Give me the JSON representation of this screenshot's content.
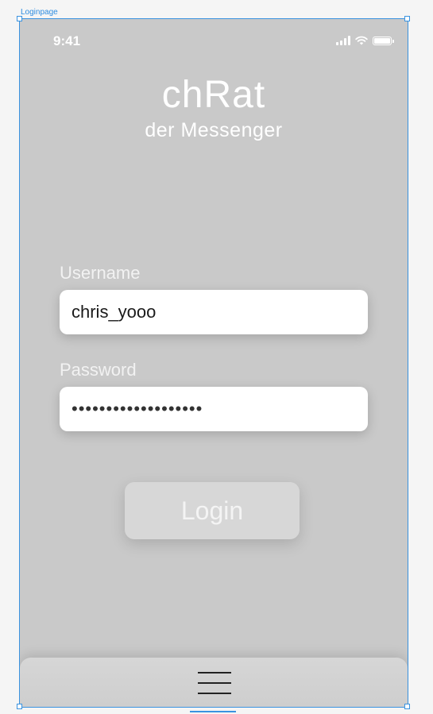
{
  "frame": {
    "label": "Loginpage"
  },
  "status_bar": {
    "time": "9:41"
  },
  "header": {
    "title": "chRat",
    "subtitle": "der Messenger"
  },
  "form": {
    "username_label": "Username",
    "username_value": "chris_yooo",
    "password_label": "Password",
    "password_value": "•••••••••••••••••••"
  },
  "login_button": {
    "label": "Login"
  },
  "icons": [
    "signal-icon",
    "wifi-icon",
    "battery-icon",
    "menu-icon"
  ]
}
